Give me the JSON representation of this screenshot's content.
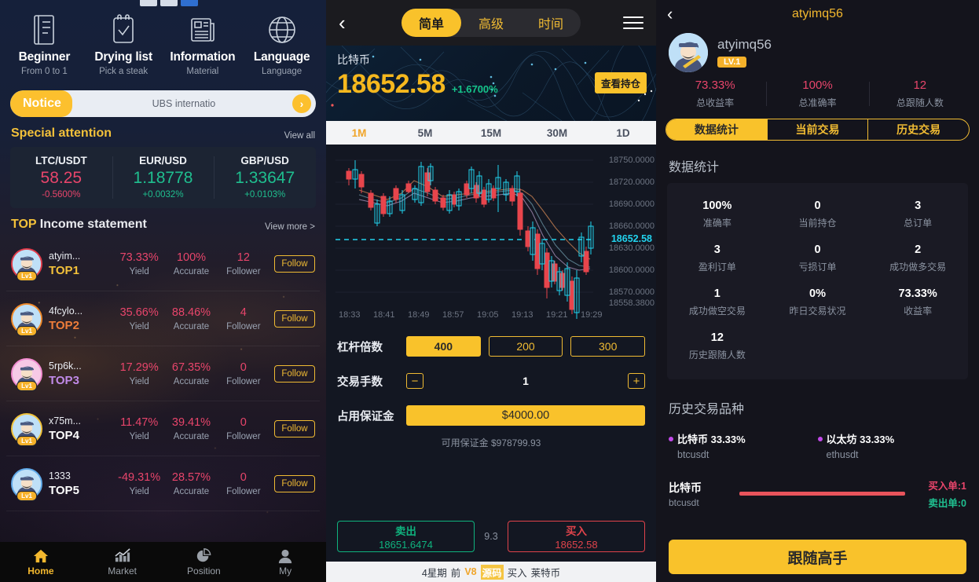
{
  "left": {
    "quick_actions": [
      {
        "icon": "book-icon",
        "title": "Beginner",
        "sub": "From 0 to 1"
      },
      {
        "icon": "checklist-icon",
        "title": "Drying list",
        "sub": "Pick a steak"
      },
      {
        "icon": "news-icon",
        "title": "Information",
        "sub": "Material"
      },
      {
        "icon": "globe-icon",
        "title": "Language",
        "sub": "Language"
      }
    ],
    "notice": {
      "tag": "Notice",
      "text": "UBS internatio",
      "arrow": "›"
    },
    "special_attention": {
      "title": "Special attention",
      "more": "View all"
    },
    "pairs": [
      {
        "name": "LTC/USDT",
        "price": "58.25",
        "change": "-0.5600%",
        "dir": "down"
      },
      {
        "name": "EUR/USD",
        "price": "1.18778",
        "change": "+0.0032%",
        "dir": "up"
      },
      {
        "name": "GBP/USD",
        "price": "1.33647",
        "change": "+0.0103%",
        "dir": "up"
      }
    ],
    "top_income": {
      "title_kw": "TOP",
      "title_rest": " Income statement",
      "more": "View more >",
      "col_labels": {
        "yield": "Yield",
        "accurate": "Accurate",
        "follower": "Follower"
      },
      "follow_label": "Follow",
      "level_badge": "Lv1",
      "rows": [
        {
          "name": "atyim...",
          "rank": "TOP1",
          "yield": "73.33%",
          "accurate": "100%",
          "follower": "12"
        },
        {
          "name": "4fcylo...",
          "rank": "TOP2",
          "yield": "35.66%",
          "accurate": "88.46%",
          "follower": "4"
        },
        {
          "name": "5rp6k...",
          "rank": "TOP3",
          "yield": "17.29%",
          "accurate": "67.35%",
          "follower": "0"
        },
        {
          "name": "x75m...",
          "rank": "TOP4",
          "yield": "11.47%",
          "accurate": "39.41%",
          "follower": "0"
        },
        {
          "name": "1333",
          "rank": "TOP5",
          "yield": "-49.31%",
          "accurate": "28.57%",
          "follower": "0"
        }
      ]
    },
    "tabbar": [
      {
        "icon": "home-icon",
        "label": "Home",
        "active": true
      },
      {
        "icon": "chart-icon",
        "label": "Market",
        "active": false
      },
      {
        "icon": "pie-icon",
        "label": "Position",
        "active": false
      },
      {
        "icon": "person-icon",
        "label": "My",
        "active": false
      }
    ]
  },
  "mid": {
    "segments": [
      {
        "label": "简单",
        "active": true
      },
      {
        "label": "高级",
        "active": false
      },
      {
        "label": "时间",
        "active": false
      }
    ],
    "hero": {
      "symbol": "比特币",
      "price": "18652.58",
      "change": "+1.6700%",
      "hold_button": "查看持仓"
    },
    "timeframes": [
      {
        "label": "1M",
        "active": true
      },
      {
        "label": "5M",
        "active": false
      },
      {
        "label": "15M",
        "active": false
      },
      {
        "label": "30M",
        "active": false
      },
      {
        "label": "1D",
        "active": false
      }
    ],
    "chart_data": {
      "type": "line",
      "title": "比特币 1M candlestick",
      "y_ticks": [
        "18750.0000",
        "18720.0000",
        "18690.0000",
        "18660.0000",
        "18630.0000",
        "18600.0000",
        "18570.0000",
        "18558.3800"
      ],
      "x_ticks": [
        "18:33",
        "18:41",
        "18:49",
        "18:57",
        "19:05",
        "19:13",
        "19:21",
        "19:29"
      ],
      "current_price_label": "18652.58",
      "ylim": [
        18558.38,
        18765.0
      ],
      "grid": true,
      "legend_position": "none",
      "xlabel": "",
      "ylabel": ""
    },
    "controls": {
      "leverage_label": "杠杆倍数",
      "leverage_options": [
        {
          "value": "400",
          "active": true
        },
        {
          "value": "200",
          "active": false
        },
        {
          "value": "300",
          "active": false
        }
      ],
      "lots_label": "交易手数",
      "lots_minus": "−",
      "lots_value": "1",
      "lots_plus": "+",
      "margin_label": "占用保证金",
      "margin_value": "$4000.00",
      "available": "可用保证金 $978799.93"
    },
    "order": {
      "sell_label": "卖出",
      "sell_price": "18651.6474",
      "spread": "9.3",
      "buy_label": "买入",
      "buy_price": "18652.58"
    },
    "footer": {
      "p1": "4星期",
      "p2": "前",
      "p3": "V8",
      "p4": "源码",
      "p5": "买入",
      "p6": "莱特币"
    }
  },
  "right": {
    "title": "atyimq56",
    "profile": {
      "username": "atyimq56",
      "level": "LV.1",
      "stats": [
        {
          "value": "73.33%",
          "label": "总收益率"
        },
        {
          "value": "100%",
          "label": "总准确率"
        },
        {
          "value": "12",
          "label": "总跟随人数"
        }
      ]
    },
    "tabs": [
      {
        "label": "数据统计",
        "active": true
      },
      {
        "label": "当前交易",
        "active": false
      },
      {
        "label": "历史交易",
        "active": false
      }
    ],
    "stats_section_title": "数据统计",
    "stats": [
      {
        "value": "100%",
        "label": "准确率"
      },
      {
        "value": "0",
        "label": "当前持仓"
      },
      {
        "value": "3",
        "label": "总订单"
      },
      {
        "value": "3",
        "label": "盈利订单"
      },
      {
        "value": "0",
        "label": "亏损订单"
      },
      {
        "value": "2",
        "label": "成功做多交易"
      },
      {
        "value": "1",
        "label": "成功做空交易"
      },
      {
        "value": "0%",
        "label": "昨日交易状况"
      },
      {
        "value": "73.33%",
        "label": "收益率"
      },
      {
        "value": "12",
        "label": "历史跟随人数"
      }
    ],
    "varieties_title": "历史交易品种",
    "varieties": [
      {
        "name": "比特币 33.33%",
        "sub": "btcusdt"
      },
      {
        "name": "以太坊 33.33%",
        "sub": "ethusdt"
      }
    ],
    "bar_row": {
      "name": "比特币",
      "sub": "btcusdt",
      "buy": "买入单:1",
      "sell": "卖出单:0"
    },
    "cta": "跟随高手"
  }
}
